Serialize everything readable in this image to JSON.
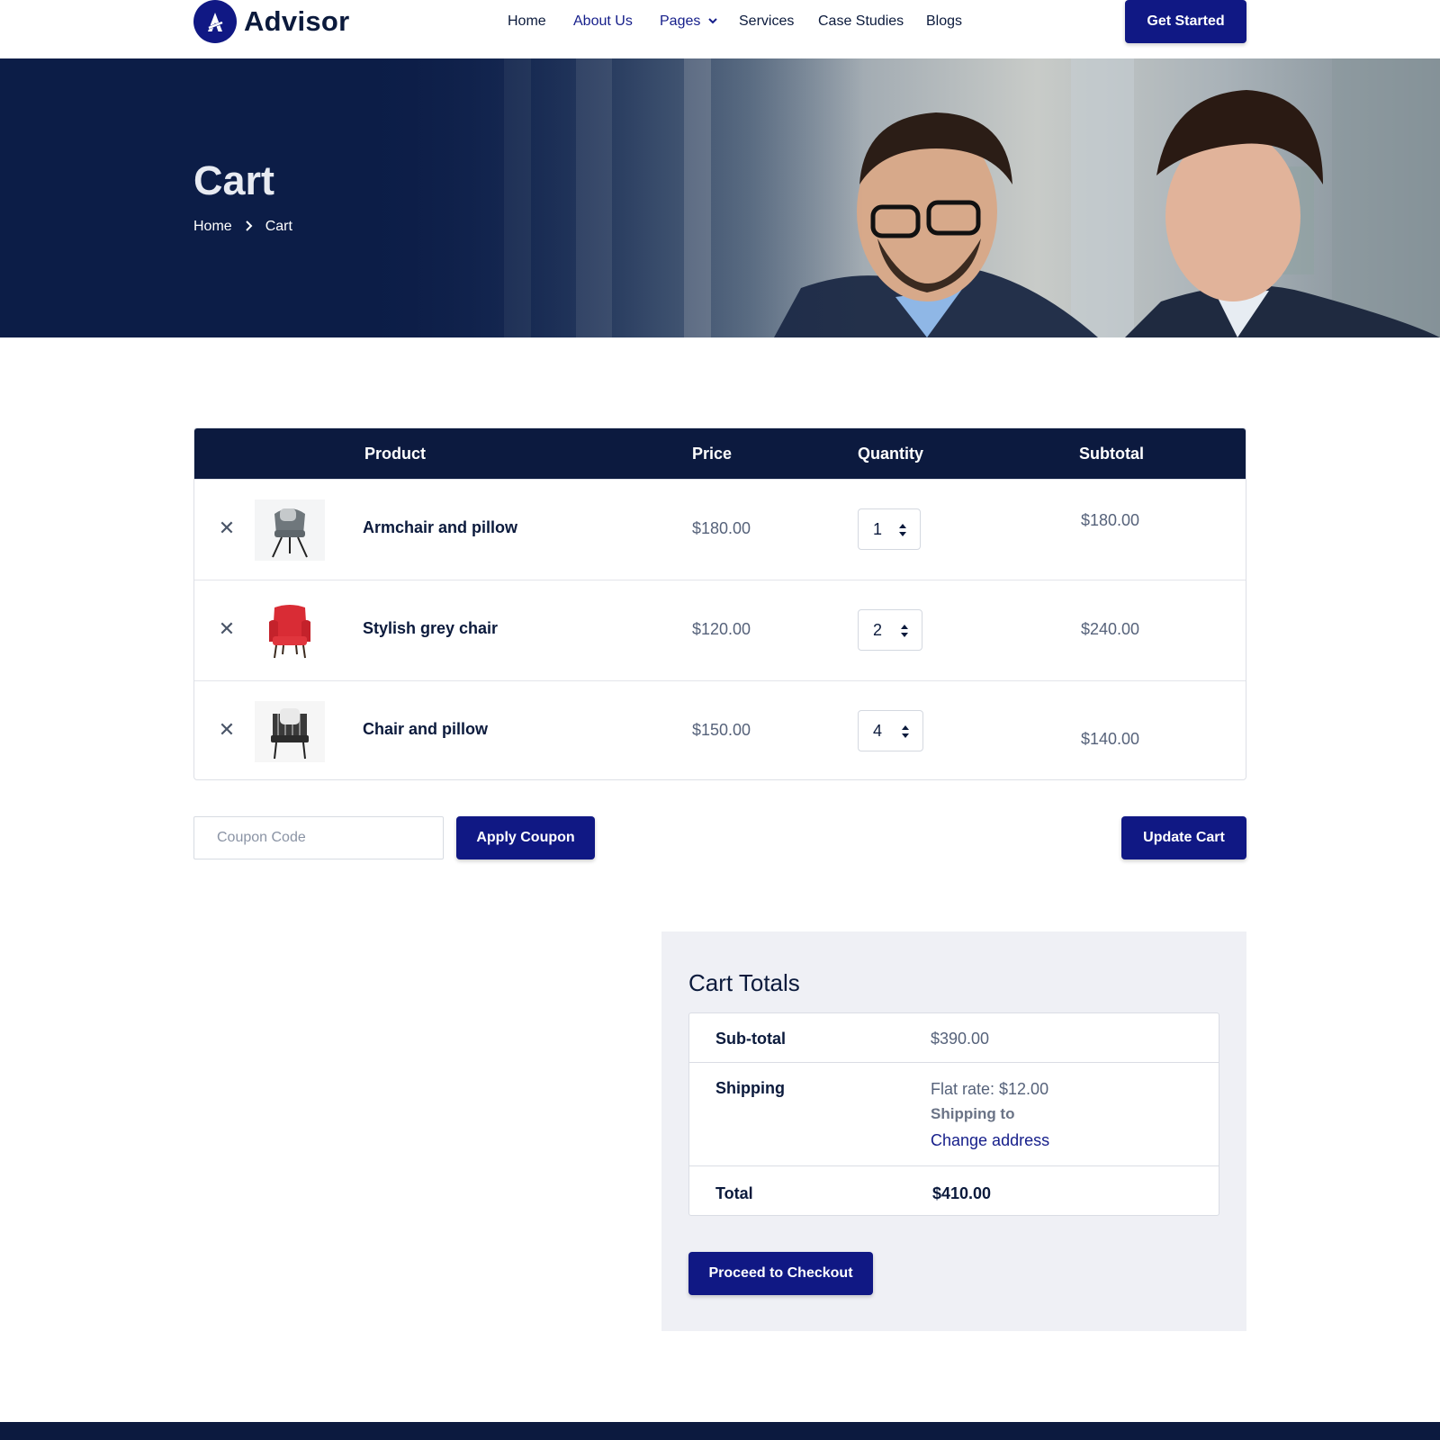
{
  "brand": {
    "name": "Advisor",
    "color": "#101884"
  },
  "nav": {
    "items": [
      {
        "label": "Home",
        "active": false
      },
      {
        "label": "About Us",
        "active": true
      },
      {
        "label": "Pages",
        "active": true,
        "has_dropdown": true
      },
      {
        "label": "Services",
        "active": false
      },
      {
        "label": "Case Studies",
        "active": false
      },
      {
        "label": "Blogs",
        "active": false
      }
    ],
    "cta_label": "Get Started"
  },
  "hero": {
    "title": "Cart",
    "breadcrumb": [
      "Home",
      "Cart"
    ]
  },
  "cart": {
    "headers": {
      "product": "Product",
      "price": "Price",
      "quantity": "Quantity",
      "subtotal": "Subtotal"
    },
    "items": [
      {
        "name": "Armchair and pillow",
        "price": "$180.00",
        "quantity": "1",
        "subtotal": "$180.00",
        "thumb_icon": "grey-armchair-icon"
      },
      {
        "name": "Stylish grey chair",
        "price": "$120.00",
        "quantity": "2",
        "subtotal": "$240.00",
        "thumb_icon": "red-wingback-chair-icon"
      },
      {
        "name": "Chair and pillow",
        "price": "$150.00",
        "quantity": "4",
        "subtotal": "$140.00",
        "thumb_icon": "checkered-chair-icon"
      }
    ],
    "coupon_placeholder": "Coupon Code",
    "apply_coupon_label": "Apply Coupon",
    "update_cart_label": "Update Cart"
  },
  "totals": {
    "title": "Cart Totals",
    "subtotal_label": "Sub-total",
    "subtotal_value": "$390.00",
    "shipping_label": "Shipping",
    "shipping_rate": "Flat rate: $12.00",
    "shipping_to": "Shipping to",
    "change_address": "Change address",
    "total_label": "Total",
    "total_value": "$410.00",
    "checkout_label": "Proceed to Checkout"
  },
  "colors": {
    "primary": "#101884",
    "dark_navy": "#0c1a3f",
    "text": "#0b1a3c",
    "muted": "#56627a",
    "panel": "#eff0f5"
  }
}
